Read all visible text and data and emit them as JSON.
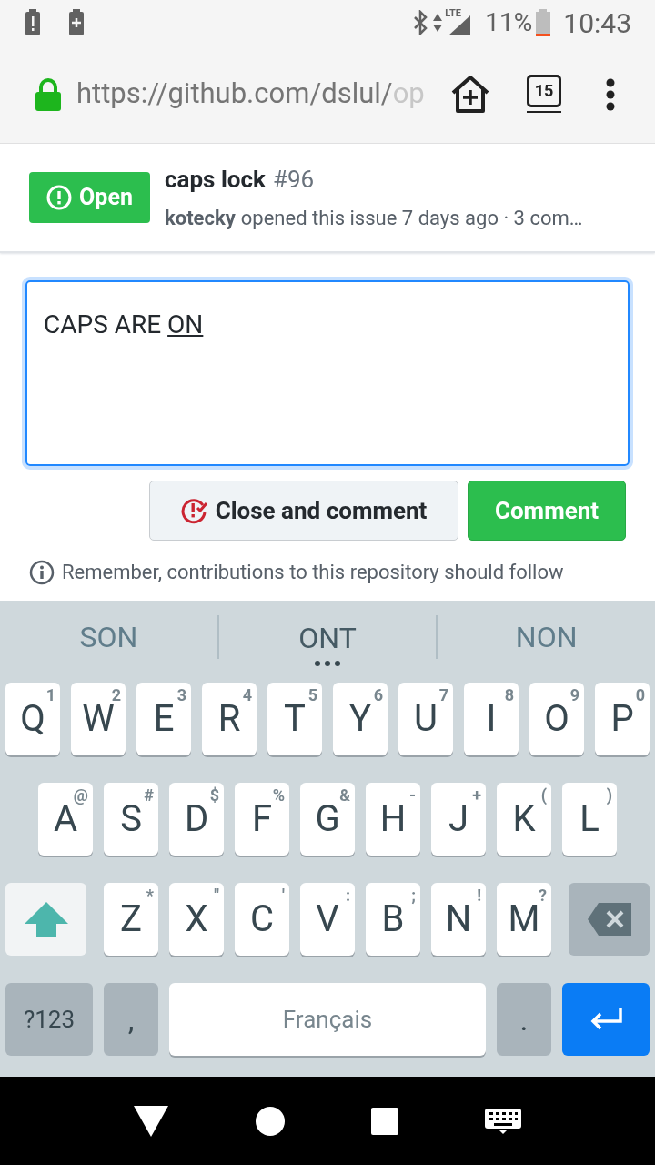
{
  "status_bar": {
    "signal_label": "LTE",
    "battery": "11%",
    "time": "10:43"
  },
  "browser": {
    "url_host": "https://github.com/dslul/",
    "url_rest": "op",
    "tab_count": "15"
  },
  "issue": {
    "state": "Open",
    "open": true,
    "title": "caps lock",
    "number": "#96",
    "author": "kotecky",
    "meta": "opened this issue 7 days ago · 3 com…"
  },
  "comment_box": {
    "value_plain": "CAPS ARE ",
    "value_underlined": "ON",
    "focused": true
  },
  "buttons": [
    {
      "kind": "close",
      "label": "Close and comment"
    },
    {
      "kind": "comment",
      "label": "Comment"
    }
  ],
  "notice": "Remember, contributions to this repository should follow",
  "keyboard": {
    "suggestions": [
      {
        "text": "SON",
        "selected": false
      },
      {
        "text": "ONT",
        "selected": true
      },
      {
        "text": "NON",
        "selected": false
      }
    ],
    "rows": [
      [
        {
          "key": "Q",
          "hint": "1"
        },
        {
          "key": "W",
          "hint": "2"
        },
        {
          "key": "E",
          "hint": "3"
        },
        {
          "key": "R",
          "hint": "4"
        },
        {
          "key": "T",
          "hint": "5"
        },
        {
          "key": "Y",
          "hint": "6"
        },
        {
          "key": "U",
          "hint": "7"
        },
        {
          "key": "I",
          "hint": "8"
        },
        {
          "key": "O",
          "hint": "9"
        },
        {
          "key": "P",
          "hint": "0"
        }
      ],
      [
        {
          "key": "A",
          "hint": "@"
        },
        {
          "key": "S",
          "hint": "#"
        },
        {
          "key": "D",
          "hint": "$"
        },
        {
          "key": "F",
          "hint": "%"
        },
        {
          "key": "G",
          "hint": "&"
        },
        {
          "key": "H",
          "hint": "-"
        },
        {
          "key": "J",
          "hint": "+"
        },
        {
          "key": "K",
          "hint": "("
        },
        {
          "key": "L",
          "hint": ")"
        }
      ],
      [
        {
          "key": "Z",
          "hint": "*"
        },
        {
          "key": "X",
          "hint": "\""
        },
        {
          "key": "C",
          "hint": "'"
        },
        {
          "key": "V",
          "hint": ":"
        },
        {
          "key": "B",
          "hint": ";"
        },
        {
          "key": "N",
          "hint": "!"
        },
        {
          "key": "M",
          "hint": "?"
        }
      ]
    ],
    "shift_locked": true,
    "symbols_key": "?123",
    "comma_key": ",",
    "space_label": "Français",
    "period_key": "."
  }
}
